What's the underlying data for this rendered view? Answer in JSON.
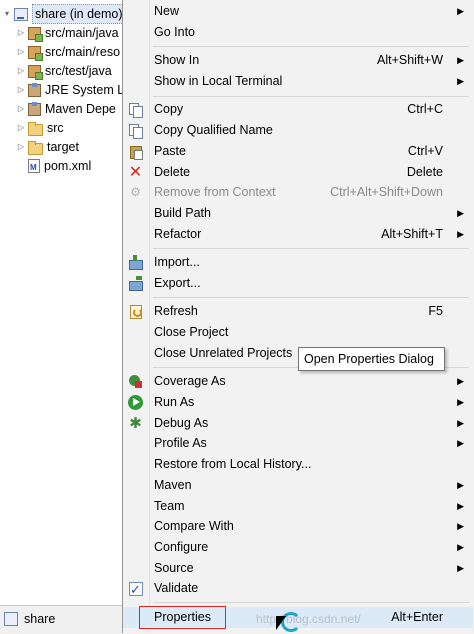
{
  "explorer": {
    "items": [
      {
        "label": "share (in demo)",
        "icon": "maven-project-icon",
        "twisty": "▾",
        "selected": true
      },
      {
        "label": "src/main/java",
        "icon": "source-folder-icon",
        "twisty": "▷"
      },
      {
        "label": "src/main/reso",
        "icon": "source-folder-icon",
        "twisty": "▷"
      },
      {
        "label": "src/test/java",
        "icon": "source-folder-icon",
        "twisty": "▷"
      },
      {
        "label": "JRE System L",
        "icon": "library-icon",
        "twisty": "▷"
      },
      {
        "label": "Maven Depe",
        "icon": "library-icon",
        "twisty": "▷"
      },
      {
        "label": "src",
        "icon": "folder-icon",
        "twisty": "▷"
      },
      {
        "label": "target",
        "icon": "folder-icon",
        "twisty": "▷"
      },
      {
        "label": "pom.xml",
        "icon": "xml-file-icon",
        "twisty": ""
      }
    ]
  },
  "status": {
    "label": "share"
  },
  "menu": {
    "new": {
      "label": "New",
      "shortcut": "",
      "submenu": true
    },
    "go_into": {
      "label": "Go Into",
      "shortcut": ""
    },
    "show_in": {
      "label": "Show In",
      "shortcut": "Alt+Shift+W",
      "submenu": true
    },
    "show_terminal": {
      "label": "Show in Local Terminal",
      "shortcut": "",
      "submenu": true
    },
    "copy": {
      "label": "Copy",
      "shortcut": "Ctrl+C"
    },
    "copy_qualified": {
      "label": "Copy Qualified Name",
      "shortcut": ""
    },
    "paste": {
      "label": "Paste",
      "shortcut": "Ctrl+V"
    },
    "delete": {
      "label": "Delete",
      "shortcut": "Delete"
    },
    "remove_context": {
      "label": "Remove from Context",
      "shortcut": "Ctrl+Alt+Shift+Down"
    },
    "build_path": {
      "label": "Build Path",
      "shortcut": "",
      "submenu": true
    },
    "refactor": {
      "label": "Refactor",
      "shortcut": "Alt+Shift+T",
      "submenu": true
    },
    "import": {
      "label": "Import...",
      "shortcut": ""
    },
    "export": {
      "label": "Export...",
      "shortcut": ""
    },
    "refresh": {
      "label": "Refresh",
      "shortcut": "F5"
    },
    "close_project": {
      "label": "Close Project",
      "shortcut": ""
    },
    "close_unrelated": {
      "label": "Close Unrelated Projects",
      "shortcut": ""
    },
    "coverage_as": {
      "label": "Coverage As",
      "submenu": true
    },
    "run_as": {
      "label": "Run As",
      "submenu": true
    },
    "debug_as": {
      "label": "Debug As",
      "submenu": true
    },
    "profile_as": {
      "label": "Profile As",
      "submenu": true
    },
    "restore_history": {
      "label": "Restore from Local History..."
    },
    "maven": {
      "label": "Maven",
      "submenu": true
    },
    "team": {
      "label": "Team",
      "submenu": true
    },
    "compare_with": {
      "label": "Compare With",
      "submenu": true
    },
    "configure": {
      "label": "Configure",
      "submenu": true
    },
    "source": {
      "label": "Source",
      "submenu": true
    },
    "validate": {
      "label": "Validate"
    },
    "properties": {
      "label": "Properties",
      "shortcut": "Alt+Enter"
    }
  },
  "tooltip": {
    "text": "Open Properties Dialog"
  },
  "arrow_glyph": "▶",
  "watermark": "http://blog.csdn.net/"
}
